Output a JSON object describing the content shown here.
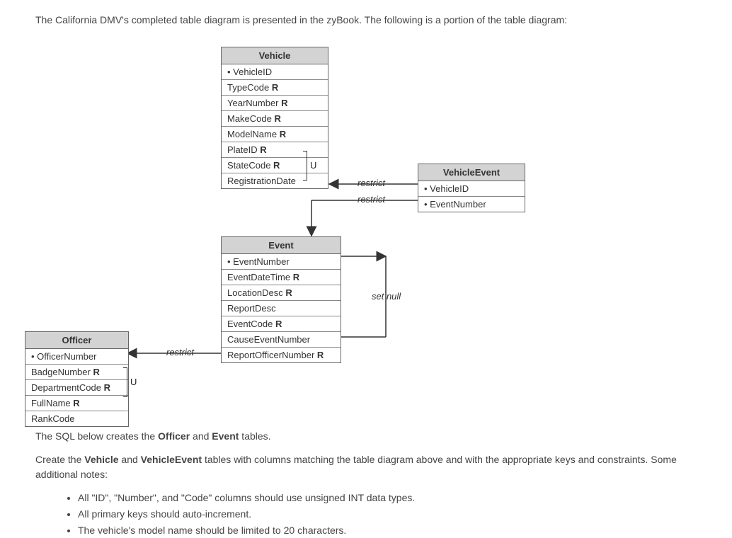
{
  "intro": "The California DMV's completed table diagram is presented in the zyBook. The following is a portion of the table diagram:",
  "entities": {
    "vehicle": {
      "title": "Vehicle",
      "cols": [
        {
          "name": "VehicleID",
          "pk": true,
          "req": false
        },
        {
          "name": "TypeCode",
          "pk": false,
          "req": true
        },
        {
          "name": "YearNumber",
          "pk": false,
          "req": true
        },
        {
          "name": "MakeCode",
          "pk": false,
          "req": true
        },
        {
          "name": "ModelName",
          "pk": false,
          "req": true
        },
        {
          "name": "PlateID",
          "pk": false,
          "req": true
        },
        {
          "name": "StateCode",
          "pk": false,
          "req": true
        },
        {
          "name": "RegistrationDate",
          "pk": false,
          "req": false
        }
      ]
    },
    "vehicleEvent": {
      "title": "VehicleEvent",
      "cols": [
        {
          "name": "VehicleID",
          "pk": true,
          "req": false
        },
        {
          "name": "EventNumber",
          "pk": true,
          "req": false
        }
      ]
    },
    "event": {
      "title": "Event",
      "cols": [
        {
          "name": "EventNumber",
          "pk": true,
          "req": false
        },
        {
          "name": "EventDateTime",
          "pk": false,
          "req": true
        },
        {
          "name": "LocationDesc",
          "pk": false,
          "req": true
        },
        {
          "name": "ReportDesc",
          "pk": false,
          "req": false
        },
        {
          "name": "EventCode",
          "pk": false,
          "req": true
        },
        {
          "name": "CauseEventNumber",
          "pk": false,
          "req": false
        },
        {
          "name": "ReportOfficerNumber",
          "pk": false,
          "req": true
        }
      ]
    },
    "officer": {
      "title": "Officer",
      "cols": [
        {
          "name": "OfficerNumber",
          "pk": true,
          "req": false
        },
        {
          "name": "BadgeNumber",
          "pk": false,
          "req": true
        },
        {
          "name": "DepartmentCode",
          "pk": false,
          "req": true
        },
        {
          "name": "FullName",
          "pk": false,
          "req": true
        },
        {
          "name": "RankCode",
          "pk": false,
          "req": false
        }
      ]
    }
  },
  "uniqueMarker": "U",
  "relLabels": {
    "restrict": "restrict",
    "setnull": "set null"
  },
  "explain": {
    "p1_pre": "The SQL below creates the ",
    "officer": "Officer",
    "p1_mid": " and ",
    "event": "Event",
    "p1_post": " tables.",
    "p2_pre": "Create the ",
    "vehicle": "Vehicle",
    "p2_mid": " and ",
    "vehicleEvent": "VehicleEvent",
    "p2_post": " tables with columns matching the table diagram above and with the appropriate keys and constraints. Some additional notes:",
    "bullets": [
      "All \"ID\", \"Number\", and \"Code\" columns should use unsigned INT data types.",
      "All primary keys should auto-increment.",
      "The vehicle's model name should be limited to 20 characters."
    ]
  }
}
